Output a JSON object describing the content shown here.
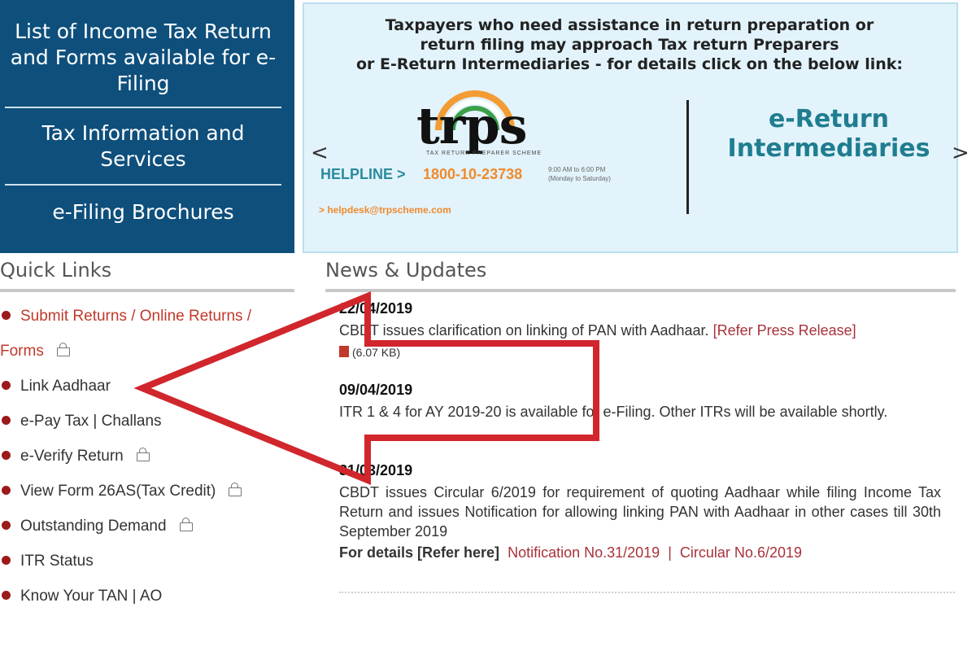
{
  "nav": {
    "item1_line1": "List of Income Tax Return",
    "item1_line2": "and Forms available for e-",
    "item1_line3": "Filing",
    "item2_line1": "Tax Information and",
    "item2_line2": "Services",
    "item3": "e-Filing Brochures"
  },
  "banner": {
    "line1": "Taxpayers who need assistance in return preparation or",
    "line2": "return filing may approach Tax return Preparers",
    "line3": "or E-Return Intermediaries - for details click on the below link:",
    "logo_text": "trps",
    "logo_subtext": "TAX RETURN   PREPARER SCHEME",
    "helpline_label": "HELPLINE >",
    "helpline_number": "1800-10-23738",
    "helpline_hours_1": "9:00 AM to 6:00 PM",
    "helpline_hours_2": "(Monday to Saturday)",
    "email": "> helpdesk@trpscheme.com",
    "eri_line1": "e-Return",
    "eri_line2": "Intermediaries",
    "prev": "<",
    "next": ">"
  },
  "quick_links": {
    "heading": "Quick Links",
    "item1_line1": "Submit Returns / Online Returns /",
    "item1_line2": "Forms",
    "items": [
      "Link Aadhaar",
      "e-Pay Tax | Challans",
      "e-Verify Return",
      "View Form 26AS(Tax Credit)",
      "Outstanding Demand",
      "ITR Status",
      "Know Your TAN | AO"
    ]
  },
  "news": {
    "heading": "News & Updates",
    "n1_date": "22/04/2019",
    "n1_text": "CBDT issues clarification on linking of PAN with Aadhaar.",
    "n1_link": "[Refer Press Release]",
    "n1_size": "(6.07 KB)",
    "n2_date": "09/04/2019",
    "n2_text": "ITR 1 & 4 for AY 2019-20 is available for e-Filing. Other ITRs will be available shortly.",
    "n3_date": "31/03/2019",
    "n3_text": "CBDT issues Circular 6/2019 for requirement of quoting Aadhaar while filing Income Tax Return and issues Notification for allowing linking PAN with Aadhaar in other cases till 30th September 2019",
    "n3_details": "For details [Refer here]",
    "n3_link1": "Notification No.31/2019",
    "n3_sep": "|",
    "n3_link2": "Circular No.6/2019"
  },
  "colors": {
    "nav_bg": "#0e4f7c",
    "link_red": "#a8323a",
    "arrow_red": "#d0262c",
    "banner_teal": "#1f7d8f"
  }
}
